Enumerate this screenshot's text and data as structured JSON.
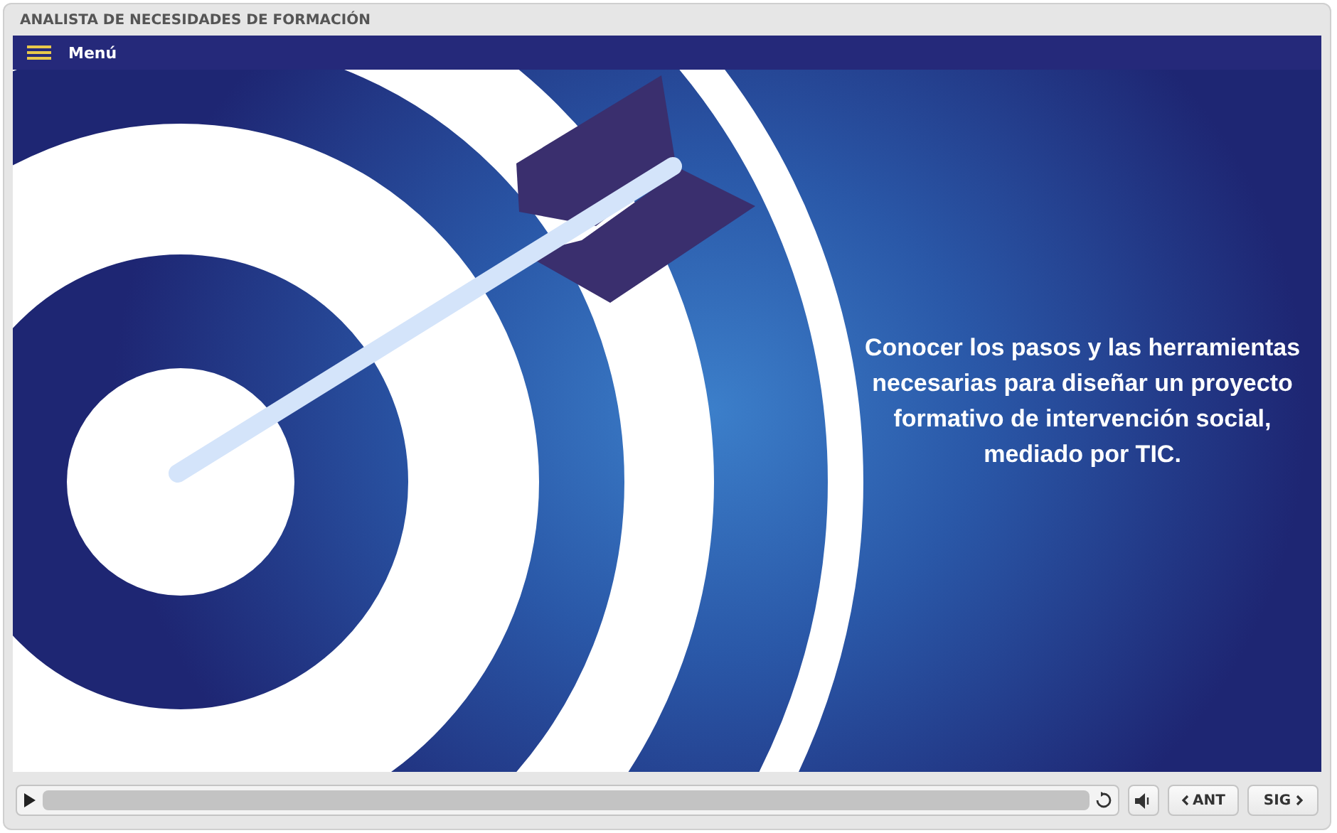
{
  "window": {
    "title": "ANALISTA DE NECESIDADES DE FORMACIÓN"
  },
  "menu": {
    "label": "Menú"
  },
  "slide": {
    "text": "Conocer los pasos y las herramientas necesarias para diseñar un proyecto formativo de intervención social, mediado por TIC."
  },
  "controls": {
    "buttons": [
      {
        "kind": "prev",
        "label": "ANT"
      },
      {
        "kind": "next",
        "label": "SIG"
      }
    ]
  }
}
